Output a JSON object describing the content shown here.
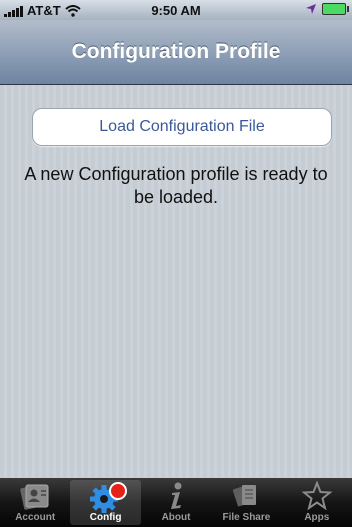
{
  "status": {
    "carrier": "AT&T",
    "time": "9:50 AM"
  },
  "nav": {
    "title": "Configuration Profile"
  },
  "content": {
    "load_button": "Load Configuration File",
    "message": "A new Configuration profile is ready to be loaded."
  },
  "tabs": [
    {
      "label": "Account",
      "icon": "account-icon"
    },
    {
      "label": "Config",
      "icon": "gear-icon",
      "active": true
    },
    {
      "label": "About",
      "icon": "info-icon"
    },
    {
      "label": "File Share",
      "icon": "file-share-icon"
    },
    {
      "label": "Apps",
      "icon": "star-icon"
    }
  ],
  "colors": {
    "nav_top": "#b2bccb",
    "nav_bottom": "#6d84a2",
    "link": "#3b5998",
    "badge": "#e62117"
  }
}
